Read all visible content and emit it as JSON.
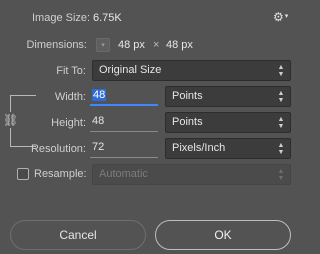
{
  "image_size": {
    "label": "Image Size:",
    "value": "6.75K"
  },
  "dimensions": {
    "label": "Dimensions:",
    "width": "48 px",
    "separator": "×",
    "height": "48 px"
  },
  "fit_to": {
    "label": "Fit To:",
    "selected": "Original Size"
  },
  "width": {
    "label": "Width:",
    "value": "48",
    "unit": "Points"
  },
  "height": {
    "label": "Height:",
    "value": "48",
    "unit": "Points"
  },
  "resolution": {
    "label": "Resolution:",
    "value": "72",
    "unit": "Pixels/Inch"
  },
  "resample": {
    "label": "Resample:",
    "checked": false,
    "method": "Automatic"
  },
  "buttons": {
    "cancel": "Cancel",
    "ok": "OK"
  },
  "icons": {
    "settings": "gear-icon",
    "chain": "link-icon",
    "dropdown": "chevron-updown-icon"
  }
}
